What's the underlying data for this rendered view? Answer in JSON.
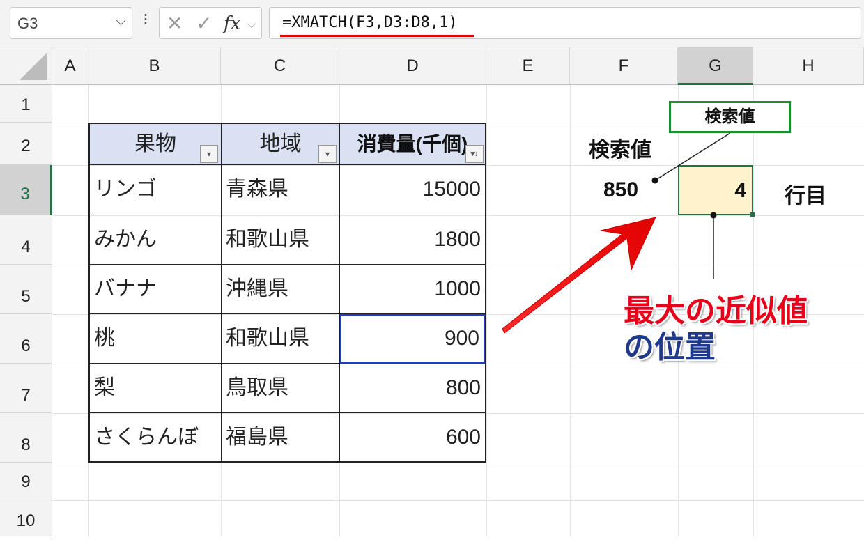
{
  "formula_bar": {
    "name_box": "G3",
    "formula": "=XMATCH(F3,D3:D8,1)"
  },
  "columns": [
    "A",
    "B",
    "C",
    "D",
    "E",
    "F",
    "G",
    "H"
  ],
  "rows": [
    "1",
    "2",
    "3",
    "4",
    "5",
    "6",
    "7",
    "8",
    "9",
    "10"
  ],
  "table": {
    "headers": [
      "果物",
      "地域",
      "消費量(千個)"
    ],
    "rows": [
      [
        "リンゴ",
        "青森県",
        "15000"
      ],
      [
        "みかん",
        "和歌山県",
        "1800"
      ],
      [
        "バナナ",
        "沖縄県",
        "1000"
      ],
      [
        "桃",
        "和歌山県",
        "900"
      ],
      [
        "梨",
        "鳥取県",
        "800"
      ],
      [
        "さくらんぼ",
        "福島県",
        "600"
      ]
    ]
  },
  "lookup": {
    "label": "検索値",
    "value": "850",
    "result": "4",
    "unit": "行目"
  },
  "annotations": {
    "callout": "検索値",
    "line1": "最大の近似値",
    "line2": "の位置"
  },
  "colors": {
    "accent_green": "#217346",
    "highlight": "#fff2cc",
    "header_fill": "#d9e1f2",
    "red": "#e8001b",
    "navy": "#1f3a8a"
  }
}
